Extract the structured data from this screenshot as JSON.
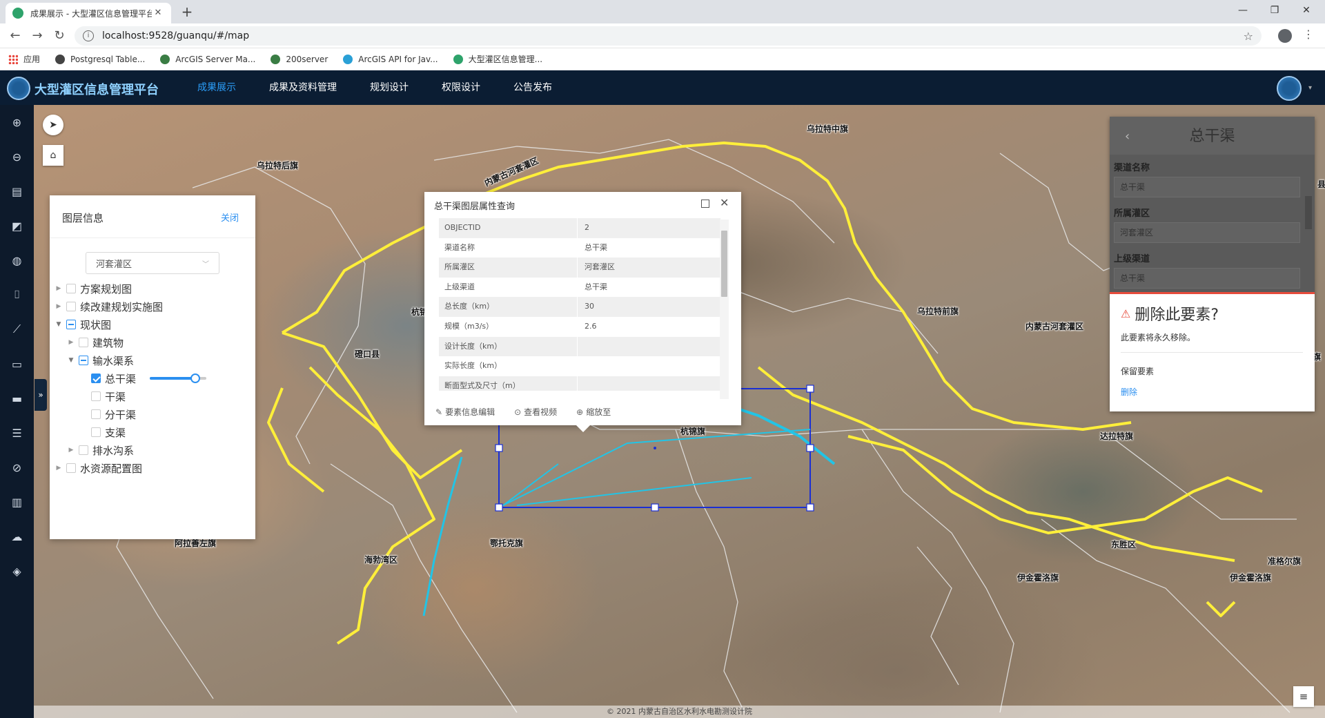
{
  "browser": {
    "tab_title": "成果展示 - 大型灌区信息管理平台",
    "url": "localhost:9528/guanqu/#/map",
    "bookmarks": [
      {
        "label": "应用",
        "color": "#e8453c"
      },
      {
        "label": "Postgresql Table...",
        "color": "#444444"
      },
      {
        "label": "ArcGIS Server Ma...",
        "color": "#3a7d44"
      },
      {
        "label": "200server",
        "color": "#3a7d44"
      },
      {
        "label": "ArcGIS API for Jav...",
        "color": "#2aa0d6"
      },
      {
        "label": "大型灌区信息管理...",
        "color": "#2ea36b"
      }
    ]
  },
  "header": {
    "title": "大型灌区信息管理平台",
    "nav": [
      {
        "label": "成果展示",
        "active": true
      },
      {
        "label": "成果及资料管理",
        "active": false
      },
      {
        "label": "规划设计",
        "active": false
      },
      {
        "label": "权限设计",
        "active": false
      },
      {
        "label": "公告发布",
        "active": false
      }
    ]
  },
  "toolbar_icons": [
    "zoom-in-icon",
    "zoom-out-icon",
    "layers-doc-icon",
    "chart-edit-icon",
    "globe-icon",
    "marker-icon",
    "polyline-icon",
    "edit-area-icon",
    "ruler-icon",
    "table-icon",
    "compass-icon",
    "bar-chart-icon",
    "upload-icon",
    "stack-icon"
  ],
  "map": {
    "places": [
      {
        "name": "乌拉特中旗"
      },
      {
        "name": "乌拉特后旗"
      },
      {
        "name": "内蒙古河套灌区"
      },
      {
        "name": "杭锦"
      },
      {
        "name": "乌拉特前旗"
      },
      {
        "name": "磴口县"
      },
      {
        "name": "内蒙古河套灌区"
      },
      {
        "name": "东河区"
      },
      {
        "name": "土默特右旗"
      },
      {
        "name": "杭锦旗"
      },
      {
        "name": "达拉特旗"
      },
      {
        "name": "阿拉善左旗"
      },
      {
        "name": "鄂托克旗"
      },
      {
        "name": "海勃湾区"
      },
      {
        "name": "东胜区"
      },
      {
        "name": "伊金霍洛旗"
      },
      {
        "name": "伊金霍洛旗"
      },
      {
        "name": "准格尔旗"
      },
      {
        "name": "县"
      }
    ],
    "copyright": "© 2021 内蒙古自治区水利水电勘测设计院"
  },
  "layer_panel": {
    "title": "图层信息",
    "close_label": "关闭",
    "region_selected": "河套灌区",
    "tree": [
      {
        "label": "方案规划图",
        "level": 0,
        "state": "unchecked",
        "expandable": true,
        "open": false
      },
      {
        "label": "续改建规划实施图",
        "level": 0,
        "state": "unchecked",
        "expandable": true,
        "open": false
      },
      {
        "label": "现状图",
        "level": 0,
        "state": "indeterminate",
        "expandable": true,
        "open": true
      },
      {
        "label": "建筑物",
        "level": 1,
        "state": "unchecked",
        "expandable": true,
        "open": false
      },
      {
        "label": "输水渠系",
        "level": 1,
        "state": "indeterminate",
        "expandable": true,
        "open": true
      },
      {
        "label": "总干渠",
        "level": 2,
        "state": "checked",
        "expandable": false,
        "opacity": 0.8
      },
      {
        "label": "干渠",
        "level": 2,
        "state": "unchecked",
        "expandable": false
      },
      {
        "label": "分干渠",
        "level": 2,
        "state": "unchecked",
        "expandable": false
      },
      {
        "label": "支渠",
        "level": 2,
        "state": "unchecked",
        "expandable": false
      },
      {
        "label": "排水沟系",
        "level": 1,
        "state": "unchecked",
        "expandable": true,
        "open": false
      },
      {
        "label": "水资源配置图",
        "level": 0,
        "state": "unchecked",
        "expandable": true,
        "open": false
      }
    ]
  },
  "attribute_popup": {
    "title": "总干渠图层属性查询",
    "rows": [
      {
        "key": "OBJECTID",
        "value": "2"
      },
      {
        "key": "渠道名称",
        "value": "总干渠"
      },
      {
        "key": "所属灌区",
        "value": "河套灌区"
      },
      {
        "key": "上级渠道",
        "value": "总干渠"
      },
      {
        "key": "总长度（km）",
        "value": "30"
      },
      {
        "key": "规模（m3/s）",
        "value": "2.6"
      },
      {
        "key": "设计长度（km）",
        "value": ""
      },
      {
        "key": "实际长度（km）",
        "value": ""
      },
      {
        "key": "断面型式及尺寸（m）",
        "value": ""
      }
    ],
    "actions": [
      {
        "label": "要素信息编辑",
        "icon": "pencil-icon"
      },
      {
        "label": "查看视频",
        "icon": "play-icon"
      },
      {
        "label": "缩放至",
        "icon": "zoom-icon"
      }
    ]
  },
  "side_panel": {
    "title": "总干渠",
    "fields": [
      {
        "label": "渠道名称",
        "value": "总干渠"
      },
      {
        "label": "所属灌区",
        "value": "河套灌区"
      },
      {
        "label": "上级渠道",
        "value": "总干渠"
      }
    ]
  },
  "confirm_dialog": {
    "title": "删除此要素?",
    "message": "此要素将永久移除。",
    "keep_label": "保留要素",
    "delete_label": "删除"
  }
}
